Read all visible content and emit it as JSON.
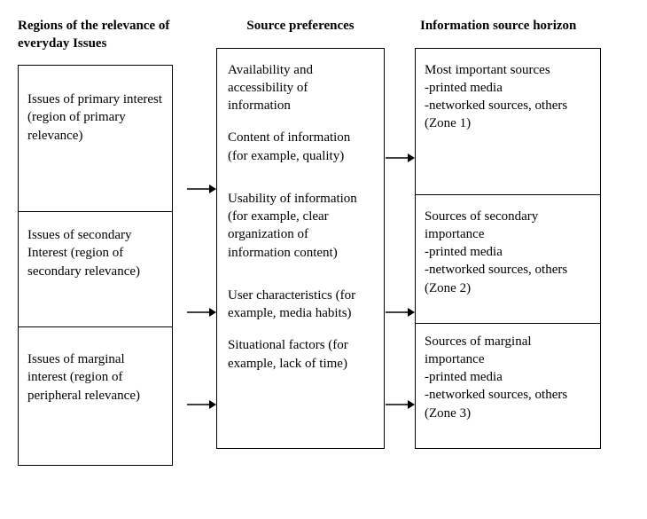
{
  "headings": {
    "col1": "Regions of the relevance of everyday Issues",
    "col2": "Source preferences",
    "col3": "Information source horizon"
  },
  "col1": {
    "r1": "Issues of primary interest (region of primary relevance)",
    "r2": "Issues of secondary Interest (region of secondary relevance)",
    "r3": "Issues of marginal interest (region of peripheral relevance)"
  },
  "col2": {
    "p1": "Availability and accessibility of information",
    "p2": "Content of information (for example, quality)",
    "p3": "Usability of information (for example, clear organization of information content)",
    "p4": "User characteristics (for example, media habits)",
    "p5": "Situational factors (for example, lack of time)"
  },
  "col3": {
    "r1": {
      "title": "Most important sources",
      "l1": "-printed media",
      "l2": "-networked sources, others",
      "zone": "(Zone 1)"
    },
    "r2": {
      "title": "Sources of secondary importance",
      "l1": "-printed media",
      "l2": "-networked sources, others",
      "zone": "(Zone 2)"
    },
    "r3": {
      "title": "Sources of marginal importance",
      "l1": "-printed media",
      "l2": "-networked sources, others",
      "zone": "(Zone 3)"
    }
  }
}
